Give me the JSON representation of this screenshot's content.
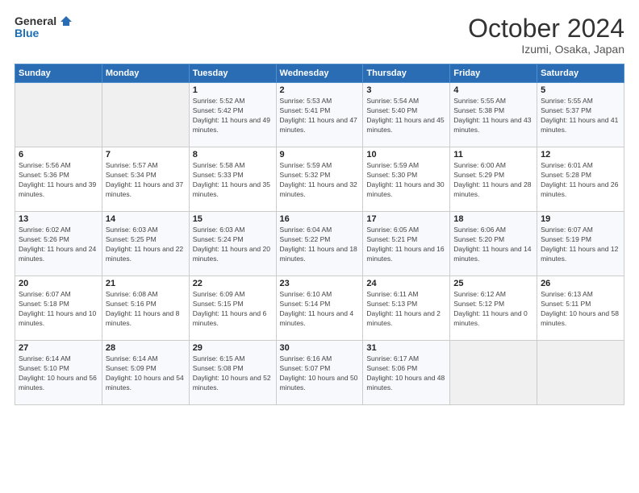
{
  "header": {
    "logo_line1": "General",
    "logo_line2": "Blue",
    "month": "October 2024",
    "location": "Izumi, Osaka, Japan"
  },
  "days_of_week": [
    "Sunday",
    "Monday",
    "Tuesday",
    "Wednesday",
    "Thursday",
    "Friday",
    "Saturday"
  ],
  "weeks": [
    [
      {
        "day": "",
        "empty": true
      },
      {
        "day": "",
        "empty": true
      },
      {
        "day": "1",
        "sunrise": "5:52 AM",
        "sunset": "5:42 PM",
        "daylight": "11 hours and 49 minutes."
      },
      {
        "day": "2",
        "sunrise": "5:53 AM",
        "sunset": "5:41 PM",
        "daylight": "11 hours and 47 minutes."
      },
      {
        "day": "3",
        "sunrise": "5:54 AM",
        "sunset": "5:40 PM",
        "daylight": "11 hours and 45 minutes."
      },
      {
        "day": "4",
        "sunrise": "5:55 AM",
        "sunset": "5:38 PM",
        "daylight": "11 hours and 43 minutes."
      },
      {
        "day": "5",
        "sunrise": "5:55 AM",
        "sunset": "5:37 PM",
        "daylight": "11 hours and 41 minutes."
      }
    ],
    [
      {
        "day": "6",
        "sunrise": "5:56 AM",
        "sunset": "5:36 PM",
        "daylight": "11 hours and 39 minutes."
      },
      {
        "day": "7",
        "sunrise": "5:57 AM",
        "sunset": "5:34 PM",
        "daylight": "11 hours and 37 minutes."
      },
      {
        "day": "8",
        "sunrise": "5:58 AM",
        "sunset": "5:33 PM",
        "daylight": "11 hours and 35 minutes."
      },
      {
        "day": "9",
        "sunrise": "5:59 AM",
        "sunset": "5:32 PM",
        "daylight": "11 hours and 32 minutes."
      },
      {
        "day": "10",
        "sunrise": "5:59 AM",
        "sunset": "5:30 PM",
        "daylight": "11 hours and 30 minutes."
      },
      {
        "day": "11",
        "sunrise": "6:00 AM",
        "sunset": "5:29 PM",
        "daylight": "11 hours and 28 minutes."
      },
      {
        "day": "12",
        "sunrise": "6:01 AM",
        "sunset": "5:28 PM",
        "daylight": "11 hours and 26 minutes."
      }
    ],
    [
      {
        "day": "13",
        "sunrise": "6:02 AM",
        "sunset": "5:26 PM",
        "daylight": "11 hours and 24 minutes."
      },
      {
        "day": "14",
        "sunrise": "6:03 AM",
        "sunset": "5:25 PM",
        "daylight": "11 hours and 22 minutes."
      },
      {
        "day": "15",
        "sunrise": "6:03 AM",
        "sunset": "5:24 PM",
        "daylight": "11 hours and 20 minutes."
      },
      {
        "day": "16",
        "sunrise": "6:04 AM",
        "sunset": "5:22 PM",
        "daylight": "11 hours and 18 minutes."
      },
      {
        "day": "17",
        "sunrise": "6:05 AM",
        "sunset": "5:21 PM",
        "daylight": "11 hours and 16 minutes."
      },
      {
        "day": "18",
        "sunrise": "6:06 AM",
        "sunset": "5:20 PM",
        "daylight": "11 hours and 14 minutes."
      },
      {
        "day": "19",
        "sunrise": "6:07 AM",
        "sunset": "5:19 PM",
        "daylight": "11 hours and 12 minutes."
      }
    ],
    [
      {
        "day": "20",
        "sunrise": "6:07 AM",
        "sunset": "5:18 PM",
        "daylight": "11 hours and 10 minutes."
      },
      {
        "day": "21",
        "sunrise": "6:08 AM",
        "sunset": "5:16 PM",
        "daylight": "11 hours and 8 minutes."
      },
      {
        "day": "22",
        "sunrise": "6:09 AM",
        "sunset": "5:15 PM",
        "daylight": "11 hours and 6 minutes."
      },
      {
        "day": "23",
        "sunrise": "6:10 AM",
        "sunset": "5:14 PM",
        "daylight": "11 hours and 4 minutes."
      },
      {
        "day": "24",
        "sunrise": "6:11 AM",
        "sunset": "5:13 PM",
        "daylight": "11 hours and 2 minutes."
      },
      {
        "day": "25",
        "sunrise": "6:12 AM",
        "sunset": "5:12 PM",
        "daylight": "11 hours and 0 minutes."
      },
      {
        "day": "26",
        "sunrise": "6:13 AM",
        "sunset": "5:11 PM",
        "daylight": "10 hours and 58 minutes."
      }
    ],
    [
      {
        "day": "27",
        "sunrise": "6:14 AM",
        "sunset": "5:10 PM",
        "daylight": "10 hours and 56 minutes."
      },
      {
        "day": "28",
        "sunrise": "6:14 AM",
        "sunset": "5:09 PM",
        "daylight": "10 hours and 54 minutes."
      },
      {
        "day": "29",
        "sunrise": "6:15 AM",
        "sunset": "5:08 PM",
        "daylight": "10 hours and 52 minutes."
      },
      {
        "day": "30",
        "sunrise": "6:16 AM",
        "sunset": "5:07 PM",
        "daylight": "10 hours and 50 minutes."
      },
      {
        "day": "31",
        "sunrise": "6:17 AM",
        "sunset": "5:06 PM",
        "daylight": "10 hours and 48 minutes."
      },
      {
        "day": "",
        "empty": true
      },
      {
        "day": "",
        "empty": true
      }
    ]
  ]
}
